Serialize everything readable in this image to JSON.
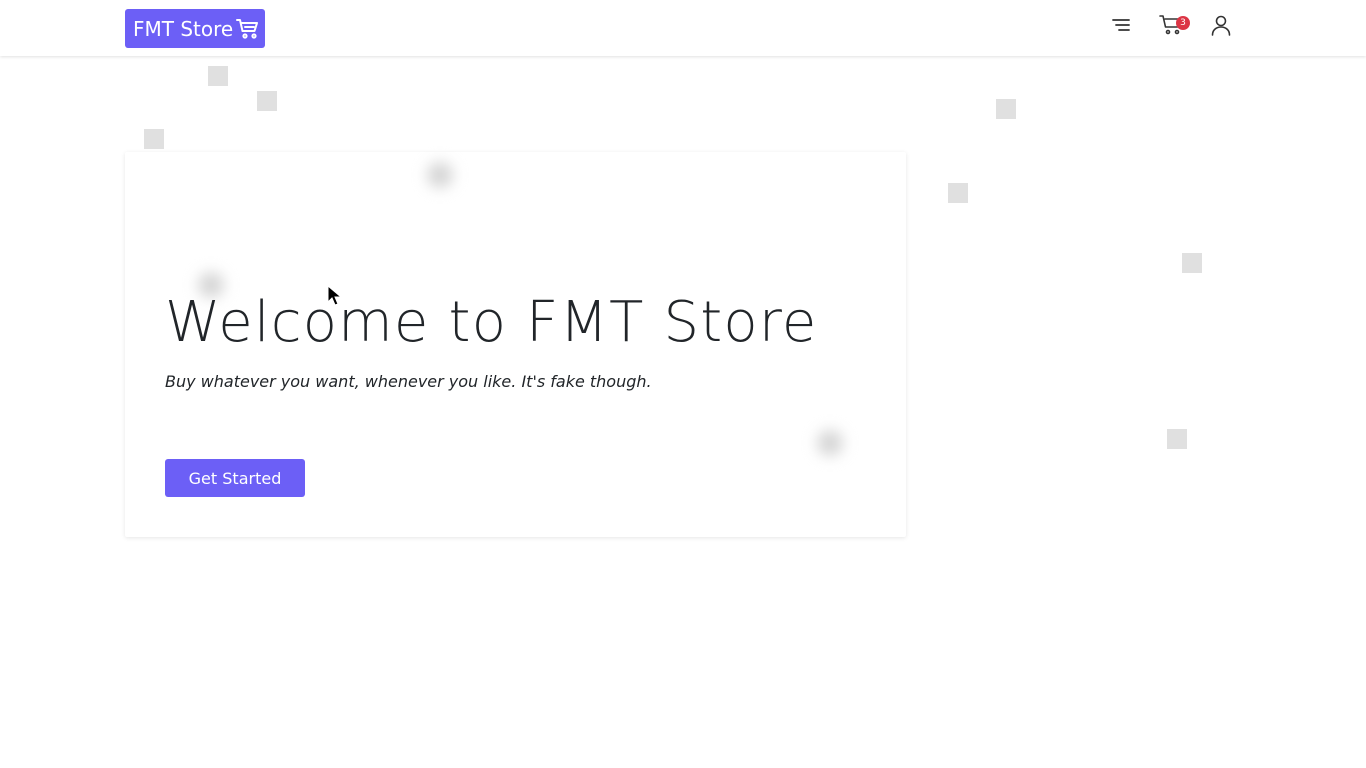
{
  "navbar": {
    "brand_label": "FMT Store",
    "brand_icon": "cart-icon",
    "menu_icon": "menu-icon",
    "cart_icon": "cart-icon",
    "cart_count": "3",
    "user_icon": "user-icon"
  },
  "hero": {
    "title": "Welcome to FMT Store",
    "subtitle": "Buy whatever you want, whenever you like. It's fake though.",
    "cta_label": "Get Started"
  },
  "colors": {
    "accent": "#6c5ff6",
    "badge": "#dc3545",
    "text": "#212529"
  }
}
